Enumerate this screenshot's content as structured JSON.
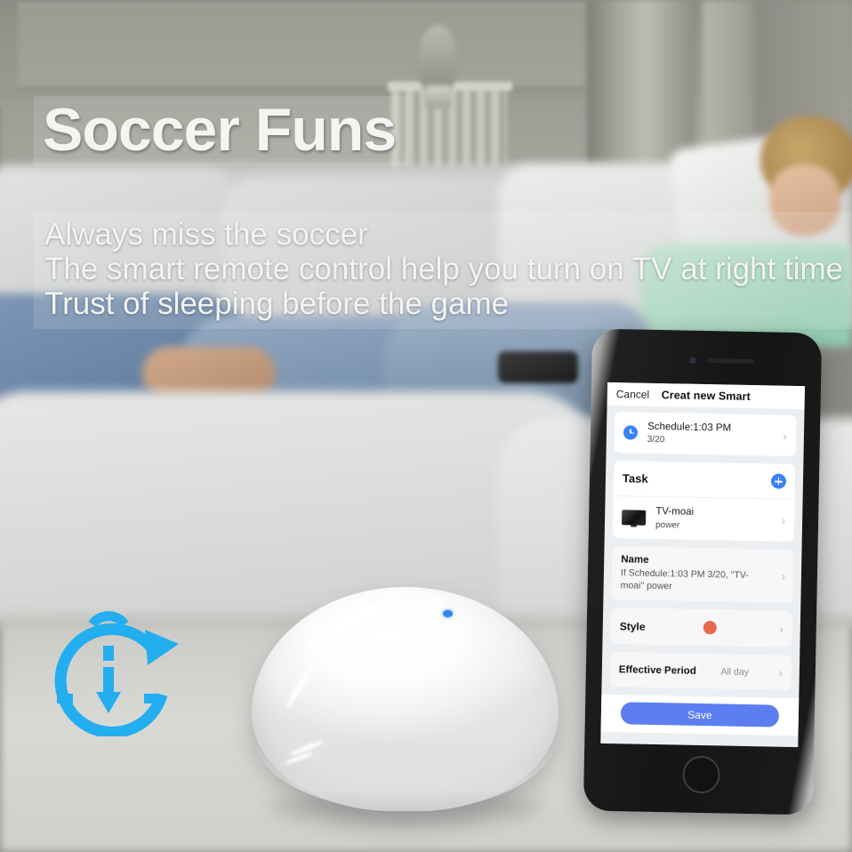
{
  "marketing": {
    "headline": "Soccer Funs",
    "sub_lines": [
      "Always miss the soccer",
      "The smart remote control help you turn on TV at right time",
      "Trust of sleeping before the game"
    ]
  },
  "icons": {
    "timer": "timer-clock-icon",
    "hub_led": "led-indicator"
  },
  "colors": {
    "timer_cyan": "#22aeef",
    "accent_blue": "#3b82f6",
    "save_blue": "#5b7ef0",
    "style_dot": "#e8674f",
    "led_blue": "#2f86f0"
  },
  "phone": {
    "navbar": {
      "cancel": "Cancel",
      "title": "Creat new Smart"
    },
    "schedule": {
      "title": "Schedule:1:03 PM",
      "subtitle": "3/20",
      "chevron": "›"
    },
    "task": {
      "header": "Task",
      "add_label": "+",
      "device": {
        "name": "TV-moai",
        "action": "power",
        "chevron": "›"
      }
    },
    "name": {
      "label": "Name",
      "value": "If Schedule:1:03 PM 3/20, \"TV-moai\" power",
      "chevron": "›"
    },
    "style": {
      "label": "Style",
      "chevron": "›"
    },
    "effective_period": {
      "label": "Effective Period",
      "value": "All day",
      "chevron": "›"
    },
    "save_button": "Save"
  }
}
